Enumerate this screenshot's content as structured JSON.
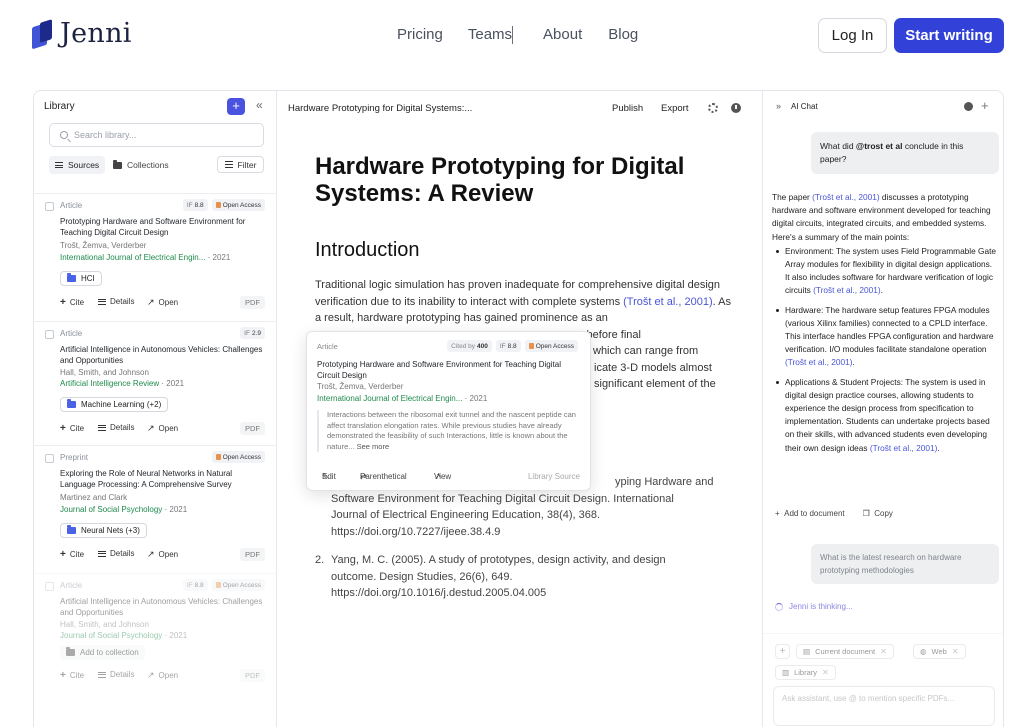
{
  "nav": {
    "brand": "Jenni",
    "links": [
      "Pricing",
      "Teams",
      "About",
      "Blog"
    ],
    "login": "Log In",
    "start": "Start writing"
  },
  "library": {
    "title": "Library",
    "add_symbol": "+",
    "collapse_symbol": "«",
    "search_placeholder": "Search library...",
    "tab_sources": "Sources",
    "tab_collections": "Collections",
    "filter": "Filter",
    "items": [
      {
        "type": "Article",
        "impact": "8.8",
        "access": "Open Access",
        "title": "Prototyping Hardware and Software Environment for Teaching Digital Circuit Design",
        "authors": "Trošt, Žemva, Verderber",
        "journal": "International Journal of Electrical Engin...",
        "year": "2021",
        "tag": "HCI",
        "cite": "Cite",
        "details": "Details",
        "open": "Open",
        "pdf": "PDF"
      },
      {
        "type": "Article",
        "impact": "2.9",
        "title": "Artificial Intelligence in Autonomous Vehicles: Challenges and Opportunities",
        "authors": "Hall, Smith, and Johnson",
        "journal": "Artificial Intelligence  Review",
        "year": "2021",
        "tag": "Machine Learning (+2)",
        "cite": "Cite",
        "details": "Details",
        "open": "Open",
        "pdf": "PDF"
      },
      {
        "type": "Preprint",
        "access": "Open Access",
        "title": "Exploring the Role of Neural Networks in Natural Language Processing: A Comprehensive Survey",
        "authors": "Martinez and Clark",
        "journal": "Journal of Social Psychology",
        "year": "2021",
        "tag": "Neural Nets (+3)",
        "cite": "Cite",
        "details": "Details",
        "open": "Open",
        "pdf": "PDF"
      },
      {
        "type": "Article",
        "impact": "8.8",
        "access": "Open Access",
        "title": "Artificial Intelligence in Autonomous Vehicles: Challenges and Opportunities",
        "authors": "Hall, Smith, and Johnson",
        "journal": "Journal of Social Psychology",
        "year": "2021",
        "tag": "Add to collection",
        "cite": "Cite",
        "details": "Details",
        "open": "Open",
        "pdf": "PDF"
      }
    ]
  },
  "document": {
    "breadcrumb": "Hardware Prototyping for Digital Systems:...",
    "publish": "Publish",
    "export": "Export",
    "title": "Hardware Prototyping for Digital Systems: A Review",
    "heading": "Introduction",
    "para_1": "Traditional logic simulation has proven inadequate for comprehensive digital design verification due to its inability to interact with complete systems ",
    "para_cite_1": "(Trošt et al., 2001)",
    "para_2": ". As a result, hardware prototyping has gained prominence as an",
    "para_3": "s before final",
    "para_4": "which can range from",
    "para_5": "icate 3-D models almost",
    "para_6": "significant element of the",
    "ref_1_tail": "yping Hardware and",
    "ref_1_rest": "Software Environment for Teaching Digital Circuit Design. International Journal of Electrical Engineering Education, 38(4), 368. https://doi.org/10.7227/ijeee.38.4.9",
    "ref_2_num": "2.",
    "ref_2": "Yang, M. C. (2005). A study of prototypes, design activity, and design outcome. Design Studies, 26(6), 649. https://doi.org/10.1016/j.destud.2005.04.005"
  },
  "popup": {
    "type": "Article",
    "cited_label": "Cited by",
    "cited_count": "400",
    "impact": "8.8",
    "access": "Open Access",
    "title": "Prototyping Hardware and Software Environment for Teaching Digital Circuit Design",
    "authors": "Trošt, Žemva, Verderber",
    "journal": "International Journal of Electrical Engin...",
    "year": "2021",
    "abstract": "Interactions between the ribosomal exit tunnel and the nascent peptide can affect translation elongation rates. While previous studies have already demonstrated the feasibility of such Interactions, little is known about the nature... ",
    "see_more": "See more",
    "edit": "Edit",
    "parenthetical": "Parenthetical",
    "view": "View",
    "source": "Library Source"
  },
  "chat": {
    "title": "AI Chat",
    "expand": "»",
    "new_symbol": "+",
    "user_q1_pre": "What did ",
    "user_q1_mention": "@trost et al",
    "user_q1_post": " conclude in this paper?",
    "ai_intro_pre": "The paper ",
    "ai_cite": "(Trošt et al., 2001)",
    "ai_intro_post": " discusses a prototyping hardware and software environment developed for teaching digital circuits, integrated circuits, and embedded systems. Here's a summary of the main points:",
    "bullet_1": "Environment: The system uses Field Programmable Gate Array modules for flexibility in digital design applications. It also includes software for hardware verification of logic circuits ",
    "bullet_2": "Hardware: The hardware setup features FPGA modules (various Xilinx families) connected to a CPLD interface. This interface handles FPGA configuration and hardware verification. I/O modules facilitate standalone operation ",
    "bullet_3": "Applications & Student Projects: The system is used in digital design practice courses, allowing students to experience the design process from specification to implementation. Students can undertake projects based on their skills, with advanced students even developing their own design ideas ",
    "add_to_doc": "Add to document",
    "copy": "Copy",
    "user_q2": "What is the latest research on hardware prototyping methodologies",
    "thinking": "Jenni is thinking...",
    "chip_current": "Current document",
    "chip_web": "Web",
    "chip_library": "Library",
    "ask_placeholder": "Ask assistant, use @ to mention specific PDFs..."
  }
}
